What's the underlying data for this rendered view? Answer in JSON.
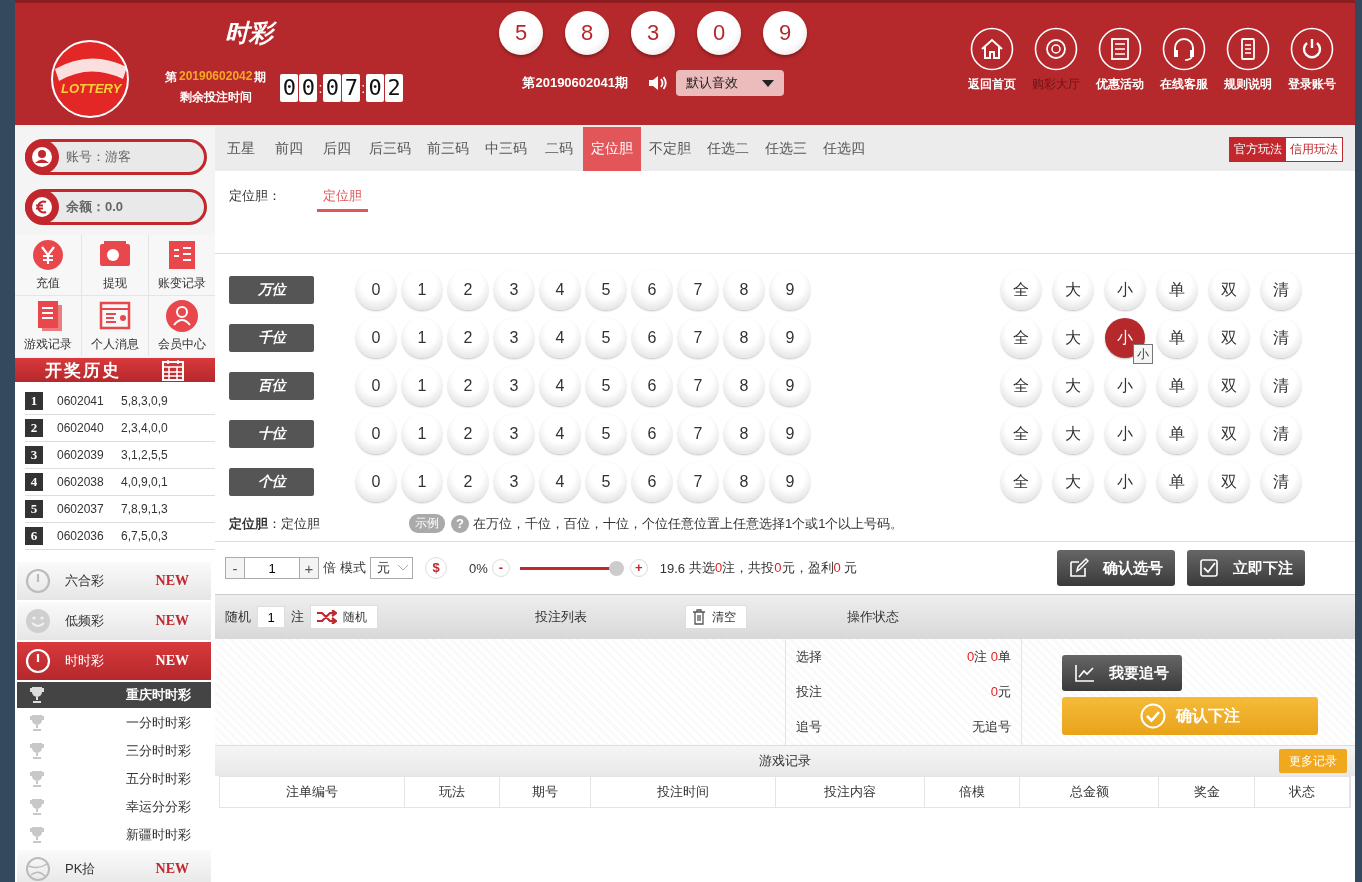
{
  "header": {
    "logo_text": "LOTTERY",
    "title": "时彩",
    "issue_prefix": "第",
    "issue": "20190602042",
    "issue_suffix": "期",
    "countdown_label": "剩余投注时间",
    "countdown": [
      {
        "kind": "digit",
        "text": "0"
      },
      {
        "kind": "digit",
        "text": "0"
      },
      {
        "kind": "sep",
        "text": ":"
      },
      {
        "kind": "digit",
        "text": "0"
      },
      {
        "kind": "digit",
        "text": "7"
      },
      {
        "kind": "sep",
        "text": ":"
      },
      {
        "kind": "digit",
        "text": "0"
      },
      {
        "kind": "digit",
        "text": "2"
      }
    ],
    "balls": [
      "5",
      "8",
      "3",
      "0",
      "9"
    ],
    "last_issue": "第20190602041期",
    "sound": "默认音效",
    "nav": [
      {
        "label": "返回首页",
        "selected": false
      },
      {
        "label": "购彩大厅",
        "selected": true
      },
      {
        "label": "优惠活动",
        "selected": false
      },
      {
        "label": "在线客服",
        "selected": false
      },
      {
        "label": "规则说明",
        "selected": false
      },
      {
        "label": "登录账号",
        "selected": false
      }
    ]
  },
  "sidebar": {
    "account": "账号：游客",
    "balance": "余额：0.0",
    "quick": [
      "充值",
      "提现",
      "账变记录",
      "游戏记录",
      "个人消息",
      "会员中心"
    ],
    "history_title": "开奖历史",
    "history": [
      {
        "rank": "1",
        "issue": "0602041",
        "numbers": "5,8,3,0,9"
      },
      {
        "rank": "2",
        "issue": "0602040",
        "numbers": "2,3,4,0,0"
      },
      {
        "rank": "3",
        "issue": "0602039",
        "numbers": "3,1,2,5,5"
      },
      {
        "rank": "4",
        "issue": "0602038",
        "numbers": "4,0,9,0,1"
      },
      {
        "rank": "5",
        "issue": "0602037",
        "numbers": "7,8,9,1,3"
      },
      {
        "rank": "6",
        "issue": "0602036",
        "numbers": "6,7,5,0,3"
      }
    ],
    "lotteries": [
      {
        "label": "六合彩",
        "badge": "NEW",
        "selected": false
      },
      {
        "label": "低频彩",
        "badge": "NEW",
        "selected": false
      },
      {
        "label": "时时彩",
        "badge": "NEW",
        "selected": true,
        "children": [
          {
            "label": "重庆时时彩",
            "selected": true
          },
          {
            "label": "一分时时彩",
            "selected": false
          },
          {
            "label": "三分时时彩",
            "selected": false
          },
          {
            "label": "五分时时彩",
            "selected": false
          },
          {
            "label": "幸运分分彩",
            "selected": false
          },
          {
            "label": "新疆时时彩",
            "selected": false
          }
        ]
      },
      {
        "label": "PK拾",
        "badge": "NEW",
        "selected": false
      }
    ]
  },
  "tabs": [
    {
      "label": "五星",
      "selected": false
    },
    {
      "label": "前四",
      "selected": false
    },
    {
      "label": "后四",
      "selected": false
    },
    {
      "label": "后三码",
      "selected": false
    },
    {
      "label": "前三码",
      "selected": false
    },
    {
      "label": "中三码",
      "selected": false
    },
    {
      "label": "二码",
      "selected": false
    },
    {
      "label": "定位胆",
      "selected": true
    },
    {
      "label": "不定胆",
      "selected": false
    },
    {
      "label": "任选二",
      "selected": false
    },
    {
      "label": "任选三",
      "selected": false
    },
    {
      "label": "任选四",
      "selected": false
    }
  ],
  "play_modes": [
    {
      "label": "官方玩法",
      "selected": true
    },
    {
      "label": "信用玩法",
      "selected": false
    }
  ],
  "subtab_label": "定位胆：",
  "subtabs": [
    {
      "label": "定位胆",
      "selected": true
    }
  ],
  "positions": [
    {
      "label": "万位",
      "digits": [
        {
          "text": "0",
          "selected": false
        },
        {
          "text": "1",
          "selected": false
        },
        {
          "text": "2",
          "selected": false
        },
        {
          "text": "3",
          "selected": false
        },
        {
          "text": "4",
          "selected": false
        },
        {
          "text": "5",
          "selected": false
        },
        {
          "text": "6",
          "selected": false
        },
        {
          "text": "7",
          "selected": false
        },
        {
          "text": "8",
          "selected": false
        },
        {
          "text": "9",
          "selected": false
        }
      ],
      "quick": [
        {
          "text": "全",
          "selected": false
        },
        {
          "text": "大",
          "selected": false
        },
        {
          "text": "小",
          "selected": false
        },
        {
          "text": "单",
          "selected": false
        },
        {
          "text": "双",
          "selected": false
        },
        {
          "text": "清",
          "selected": false
        }
      ]
    },
    {
      "label": "千位",
      "digits": [
        {
          "text": "0",
          "selected": false
        },
        {
          "text": "1",
          "selected": false
        },
        {
          "text": "2",
          "selected": false
        },
        {
          "text": "3",
          "selected": false
        },
        {
          "text": "4",
          "selected": false
        },
        {
          "text": "5",
          "selected": false
        },
        {
          "text": "6",
          "selected": false
        },
        {
          "text": "7",
          "selected": false
        },
        {
          "text": "8",
          "selected": false
        },
        {
          "text": "9",
          "selected": false
        }
      ],
      "quick": [
        {
          "text": "全",
          "selected": false
        },
        {
          "text": "大",
          "selected": false
        },
        {
          "text": "小",
          "selected": true,
          "tooltip": "小"
        },
        {
          "text": "单",
          "selected": false
        },
        {
          "text": "双",
          "selected": false
        },
        {
          "text": "清",
          "selected": false
        }
      ]
    },
    {
      "label": "百位",
      "digits": [
        {
          "text": "0",
          "selected": false
        },
        {
          "text": "1",
          "selected": false
        },
        {
          "text": "2",
          "selected": false
        },
        {
          "text": "3",
          "selected": false
        },
        {
          "text": "4",
          "selected": false
        },
        {
          "text": "5",
          "selected": false
        },
        {
          "text": "6",
          "selected": false
        },
        {
          "text": "7",
          "selected": false
        },
        {
          "text": "8",
          "selected": false
        },
        {
          "text": "9",
          "selected": false
        }
      ],
      "quick": [
        {
          "text": "全",
          "selected": false
        },
        {
          "text": "大",
          "selected": false
        },
        {
          "text": "小",
          "selected": false
        },
        {
          "text": "单",
          "selected": false
        },
        {
          "text": "双",
          "selected": false
        },
        {
          "text": "清",
          "selected": false
        }
      ]
    },
    {
      "label": "十位",
      "digits": [
        {
          "text": "0",
          "selected": false
        },
        {
          "text": "1",
          "selected": false
        },
        {
          "text": "2",
          "selected": false
        },
        {
          "text": "3",
          "selected": false
        },
        {
          "text": "4",
          "selected": false
        },
        {
          "text": "5",
          "selected": false
        },
        {
          "text": "6",
          "selected": false
        },
        {
          "text": "7",
          "selected": false
        },
        {
          "text": "8",
          "selected": false
        },
        {
          "text": "9",
          "selected": false
        }
      ],
      "quick": [
        {
          "text": "全",
          "selected": false
        },
        {
          "text": "大",
          "selected": false
        },
        {
          "text": "小",
          "selected": false
        },
        {
          "text": "单",
          "selected": false
        },
        {
          "text": "双",
          "selected": false
        },
        {
          "text": "清",
          "selected": false
        }
      ]
    },
    {
      "label": "个位",
      "digits": [
        {
          "text": "0",
          "selected": false
        },
        {
          "text": "1",
          "selected": false
        },
        {
          "text": "2",
          "selected": false
        },
        {
          "text": "3",
          "selected": false
        },
        {
          "text": "4",
          "selected": false
        },
        {
          "text": "5",
          "selected": false
        },
        {
          "text": "6",
          "selected": false
        },
        {
          "text": "7",
          "selected": false
        },
        {
          "text": "8",
          "selected": false
        },
        {
          "text": "9",
          "selected": false
        }
      ],
      "quick": [
        {
          "text": "全",
          "selected": false
        },
        {
          "text": "大",
          "selected": false
        },
        {
          "text": "小",
          "selected": false
        },
        {
          "text": "单",
          "selected": false
        },
        {
          "text": "双",
          "selected": false
        },
        {
          "text": "清",
          "selected": false
        }
      ]
    }
  ],
  "description": {
    "label": "**定位胆**：定位胆",
    "example": "示例",
    "help": "?",
    "text": "在万位，千位，百位，十位，个位任意位置上任意选择1个或1个以上号码。"
  },
  "bet_bar": {
    "minus": "-",
    "multiplier": "1",
    "plus": "+",
    "times": "倍",
    "mode_label": "模式",
    "unit": "元",
    "dollar": "$",
    "rebate": "0%",
    "slider_minus": "-",
    "slider_plus": "+",
    "level": 0.97,
    "odds": "19.6",
    "summary": [
      {
        "kind": "plain",
        "text": "共选"
      },
      {
        "kind": "value",
        "text": "0"
      },
      {
        "kind": "plain",
        "text": "注，共投"
      },
      {
        "kind": "value",
        "text": "0"
      },
      {
        "kind": "plain",
        "text": "元，盈利"
      },
      {
        "kind": "value",
        "text": "0"
      },
      {
        "kind": "plain",
        "text": " 元"
      }
    ],
    "buttons": [
      "确认选号",
      "立即下注"
    ]
  },
  "bet_list": {
    "random_label": "随机",
    "random_count": "1",
    "random_unit": "注",
    "random_button": "随机",
    "title": "投注列表",
    "clear": "清空",
    "status_title": "操作状态",
    "status": [
      {
        "label": "选择",
        "parts": [
          {
            "kind": "value",
            "text": "0"
          },
          {
            "kind": "plain",
            "text": "注 "
          },
          {
            "kind": "value",
            "text": "0"
          },
          {
            "kind": "plain",
            "text": "单"
          }
        ]
      },
      {
        "label": "投注",
        "parts": [
          {
            "kind": "value",
            "text": "0"
          },
          {
            "kind": "plain",
            "text": "元"
          }
        ]
      },
      {
        "label": "追号",
        "parts": [
          {
            "kind": "plain",
            "text": "无追号"
          }
        ]
      }
    ],
    "chase_button": "我要追号",
    "confirm_button": "确认下注"
  },
  "records": {
    "title": "游戏记录",
    "more": "更多记录",
    "columns": [
      "注单编号",
      "玩法",
      "期号",
      "投注时间",
      "投注内容",
      "倍模",
      "总金额",
      "奖金",
      "状态"
    ]
  }
}
